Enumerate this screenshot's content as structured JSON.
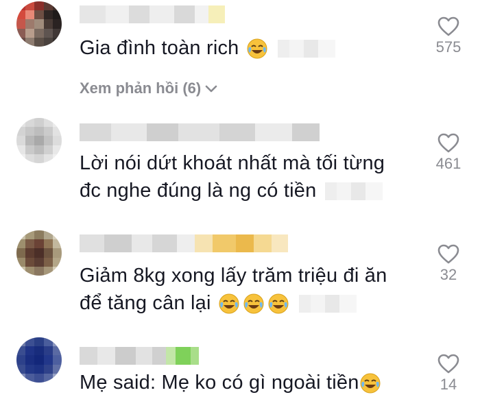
{
  "comments": [
    {
      "text_lines": [
        "Gia đình toàn rich"
      ],
      "emoji_count": 1,
      "likes": "575",
      "replies_label": "Xem phản hồi (6)"
    },
    {
      "text_lines": [
        "Lời nói dứt khoát nhất mà tối từng",
        "đc nghe đúng là ng có tiền"
      ],
      "emoji_count": 0,
      "likes": "461"
    },
    {
      "text_lines": [
        "Giảm 8kg xong lấy trăm triệu đi ăn",
        "để tăng cân lại"
      ],
      "emoji_count": 3,
      "likes": "32"
    },
    {
      "text_lines": [
        "Mẹ said: Mẹ ko có gì ngoài tiền"
      ],
      "emoji_count": 1,
      "likes": "14"
    }
  ],
  "icons": {
    "like": "heart-outline-icon",
    "emoji": "tears-of-joy-emoji-icon",
    "expand": "chevron-down-icon"
  },
  "colors": {
    "text": "#161823",
    "muted": "#8a8b91",
    "emoji_face": "#f7c23c"
  }
}
